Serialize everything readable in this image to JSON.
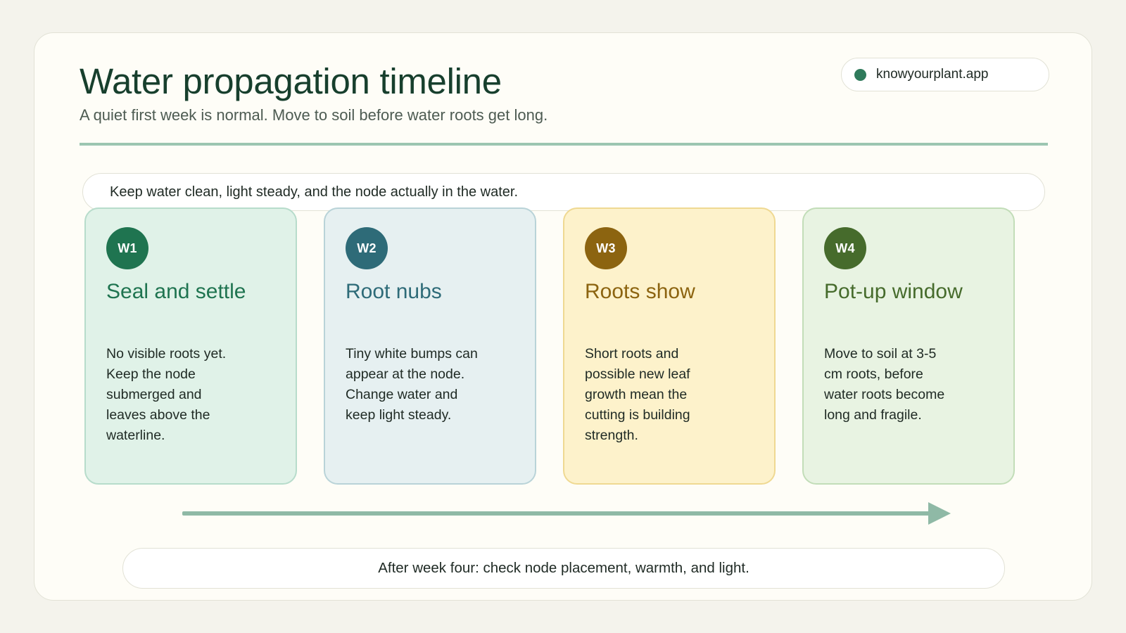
{
  "header": {
    "title": "Water propagation timeline",
    "subtitle": "A quiet first week is normal. Move to soil before water roots get long."
  },
  "brand": {
    "label": "knowyourplant.app",
    "dot_color": "#2f7a5b"
  },
  "tip": "Keep water clean, light steady, and the node actually in the water.",
  "stages": [
    {
      "badge": "W1",
      "title": "Seal and settle",
      "body": "No visible roots yet. Keep the node submerged and leaves above the waterline.",
      "accent": "#1f7450"
    },
    {
      "badge": "W2",
      "title": "Root nubs",
      "body": "Tiny white bumps can appear at the node. Change water and keep light steady.",
      "accent": "#2e6b78"
    },
    {
      "badge": "W3",
      "title": "Roots show",
      "body": "Short roots and possible new leaf growth mean the cutting is building strength.",
      "accent": "#8c6410"
    },
    {
      "badge": "W4",
      "title": "Pot-up window",
      "body": "Move to soil at 3-5 cm roots, before water roots become long and fragile.",
      "accent": "#466b2c"
    }
  ],
  "footer": "After week four: check node placement, warmth, and light."
}
